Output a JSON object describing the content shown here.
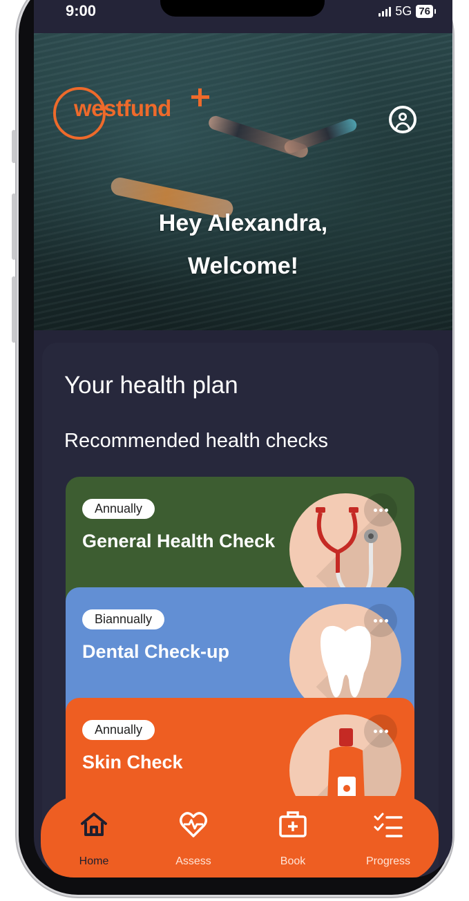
{
  "status_bar": {
    "time": "9:00",
    "network": "5G",
    "battery": "76"
  },
  "hero": {
    "brand": "westfund",
    "greeting_line1": "Hey Alexandra,",
    "greeting_line2": "Welcome!",
    "profile_icon": "user-circle-icon"
  },
  "health_plan": {
    "title": "Your health plan",
    "subtitle": "Recommended health checks",
    "checks": [
      {
        "frequency": "Annually",
        "name": "General Health Check",
        "color": "#3d5d31",
        "icon": "stethoscope-icon"
      },
      {
        "frequency": "Biannually",
        "name": "Dental Check-up",
        "color": "#628fd4",
        "icon": "tooth-icon"
      },
      {
        "frequency": "Annually",
        "name": "Skin Check",
        "color": "#ee5e22",
        "icon": "sunscreen-bottle-icon"
      }
    ]
  },
  "bottom_nav": {
    "items": [
      {
        "label": "Home",
        "icon": "home-icon",
        "active": true
      },
      {
        "label": "Assess",
        "icon": "heart-pulse-icon",
        "active": false
      },
      {
        "label": "Book",
        "icon": "medical-kit-icon",
        "active": false
      },
      {
        "label": "Progress",
        "icon": "checklist-icon",
        "active": false
      }
    ]
  },
  "colors": {
    "accent": "#ee5e22",
    "background": "#242438",
    "card": "#27283c"
  }
}
